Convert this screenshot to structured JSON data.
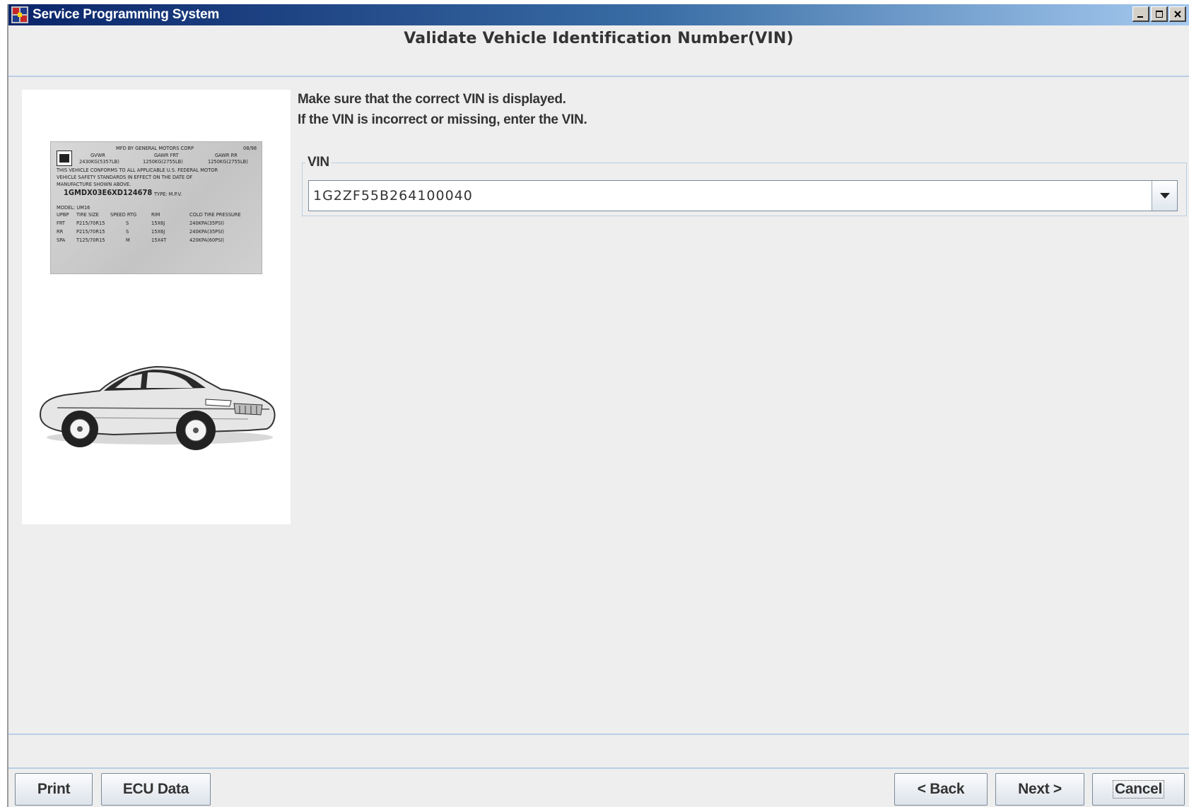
{
  "window": {
    "title": "Service Programming System",
    "icon": "service-programming-app-icon",
    "controls": [
      "minimize-icon",
      "maximize-icon",
      "close-icon"
    ]
  },
  "page": {
    "heading": "Validate Vehicle Identification Number(VIN)",
    "instruction_line1": "Make sure that the correct VIN is displayed.",
    "instruction_line2": "If the VIN is incorrect or missing, enter the VIN."
  },
  "vin": {
    "legend": "VIN",
    "value": "1G2ZF55B264100040"
  },
  "label_plate": {
    "manufacturer": "MFD BY GENERAL MOTORS CORP",
    "date": "08/98",
    "gvwr_h": "GVWR",
    "gvwr": "2430KG(5357LB)",
    "gawr_frt_h": "GAWR FRT",
    "gawr_frt": "1250KG(2755LB)",
    "gawr_rr_h": "GAWR RR",
    "gawr_rr": "1250KG(2755LB)",
    "conform1": "THIS VEHICLE CONFORMS TO ALL APPLICABLE U.S. FEDERAL MOTOR",
    "conform2": "VEHICLE SAFETY STANDARDS IN EFFECT ON THE DATE OF",
    "conform3": "MANUFACTURE SHOWN ABOVE.",
    "vin": "1GMDX03E6XD124678",
    "type": "TYPE: M.P.V.",
    "model": "MODEL: UM16",
    "hdr": [
      "UPBP",
      "TIRE SIZE",
      "SPEED RTG",
      "RIM",
      "COLD TIRE PRESSURE"
    ],
    "rows": [
      [
        "FRT",
        "P215/70R15",
        "S",
        "15X6J",
        "240KPA(35PSI)"
      ],
      [
        "RR",
        "P215/70R15",
        "S",
        "15X6J",
        "240KPA(35PSI)"
      ],
      [
        "SPA",
        "T125/70R15",
        "M",
        "15X4T",
        "420KPA(60PSI)"
      ]
    ]
  },
  "buttons": {
    "print": "Print",
    "ecu_data": "ECU Data",
    "back": "< Back",
    "next": "Next >",
    "cancel": "Cancel"
  },
  "colors": {
    "titlebar_start": "#0a246a",
    "titlebar_end": "#a6caf0",
    "panel_bg": "#eeeeee",
    "separator": "#b8cfe5"
  }
}
